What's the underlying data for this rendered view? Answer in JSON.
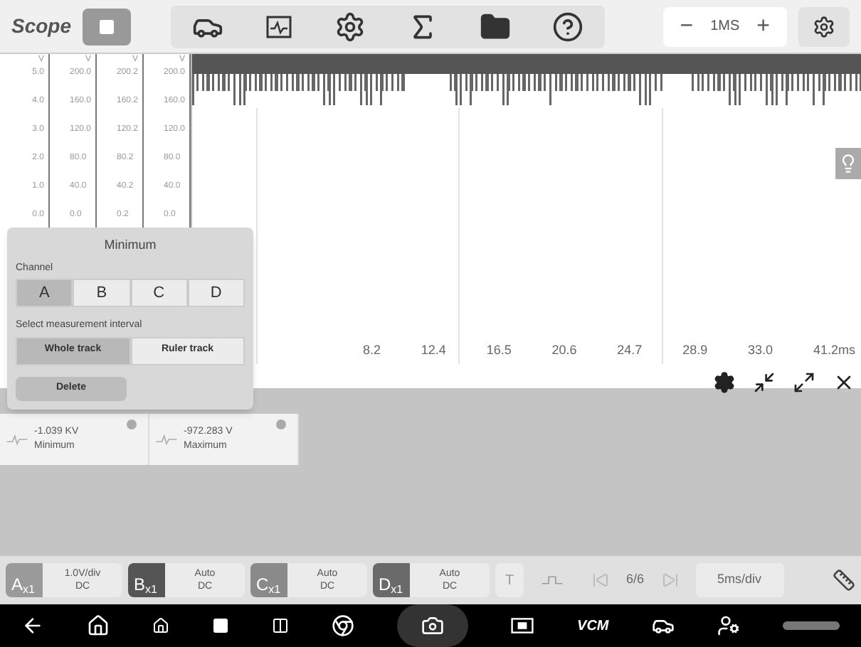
{
  "toolbar": {
    "title": "Scope",
    "timebase": {
      "minus": "−",
      "value": "1MS",
      "plus": "+"
    }
  },
  "axes": [
    {
      "unit": "V",
      "ticks": [
        "5.0",
        "4.0",
        "3.0",
        "2.0",
        "1.0",
        "0.0"
      ]
    },
    {
      "unit": "V",
      "ticks": [
        "200.0",
        "160.0",
        "120.0",
        "80.0",
        "40.0",
        "0.0"
      ]
    },
    {
      "unit": "V",
      "ticks": [
        "200.2",
        "160.2",
        "120.2",
        "80.2",
        "40.2",
        "0.2"
      ]
    },
    {
      "unit": "V",
      "ticks": [
        "200.0",
        "160.0",
        "120.0",
        "80.0",
        "40.0",
        "0.0"
      ]
    }
  ],
  "x_ticks": [
    "8.2",
    "12.4",
    "16.5",
    "20.6",
    "24.7",
    "28.9",
    "33.0",
    "41.2ms"
  ],
  "popup": {
    "title": "Minimum",
    "channel_label": "Channel",
    "channels": [
      {
        "label": "A",
        "selected": true
      },
      {
        "label": "B",
        "selected": false
      },
      {
        "label": "C",
        "selected": false
      },
      {
        "label": "D",
        "selected": false
      }
    ],
    "interval_label": "Select measurement interval",
    "intervals": [
      {
        "label": "Whole track",
        "selected": true
      },
      {
        "label": "Ruler track",
        "selected": false
      }
    ],
    "delete": "Delete"
  },
  "measurements": [
    {
      "value": "-1.039 KV",
      "name": "Minimum"
    },
    {
      "value": "-972.283 V",
      "name": "Maximum"
    }
  ],
  "channel_bar": [
    {
      "letter": "A",
      "probe": "x1",
      "scale": "1.0V/div",
      "coupling": "DC",
      "color": "#9a9a9a"
    },
    {
      "letter": "B",
      "probe": "x1",
      "scale": "Auto",
      "coupling": "DC",
      "color": "#555555"
    },
    {
      "letter": "C",
      "probe": "x1",
      "scale": "Auto",
      "coupling": "DC",
      "color": "#8a8a8a"
    },
    {
      "letter": "D",
      "probe": "x1",
      "scale": "Auto",
      "coupling": "DC",
      "color": "#6a6a6a"
    }
  ],
  "trigger": "T",
  "page": "6/6",
  "timediv": "5ms/div",
  "nav": {
    "vcm": "VCM"
  }
}
